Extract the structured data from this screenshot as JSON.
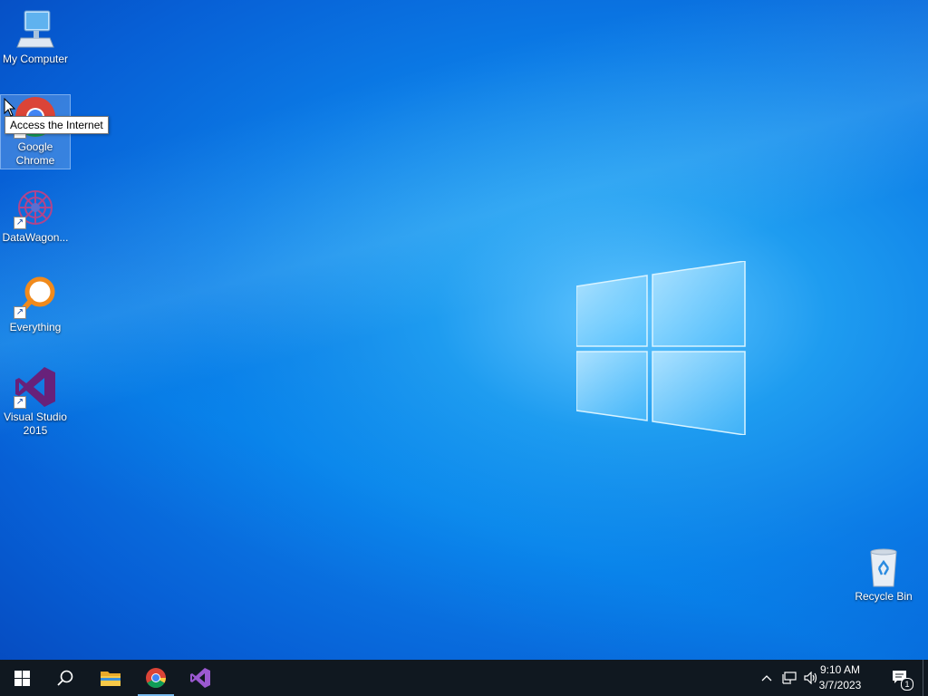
{
  "desktop": {
    "icons": [
      {
        "name": "my-computer",
        "label": "My Computer"
      },
      {
        "name": "google-chrome",
        "label": "Google Chrome"
      },
      {
        "name": "datawagon",
        "label": "DataWagon..."
      },
      {
        "name": "everything",
        "label": "Everything"
      },
      {
        "name": "visual-studio-2015",
        "label": "Visual Studio 2015"
      }
    ],
    "recycle_bin": {
      "label": "Recycle Bin"
    },
    "tooltip": "Access the Internet"
  },
  "taskbar": {
    "buttons": [
      "start-icon",
      "search-icon",
      "file-explorer-icon",
      "chrome-icon",
      "visual-studio-icon"
    ],
    "tray": [
      "chevron-up-icon",
      "network-icon",
      "volume-icon"
    ],
    "clock": {
      "time": "9:10 AM",
      "date": "3/7/2023"
    },
    "notifications": {
      "count": "1"
    }
  },
  "colors": {
    "accent": "#0b7be6",
    "taskbar": "#101820"
  }
}
